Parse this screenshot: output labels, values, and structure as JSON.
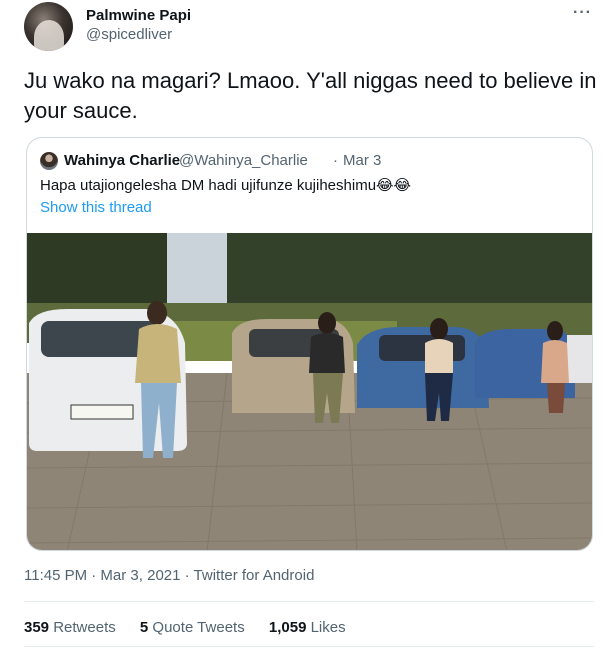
{
  "author": {
    "name": "Palmwine Papi",
    "handle": "@spicedliver"
  },
  "more_icon": "more-dots-icon",
  "tweet_text": "Ju wako na magari? Lmaoo. Y'all niggas need to believe in your sauce.",
  "quote": {
    "name": "Wahinya Charlie",
    "handle": "@Wahinya_Charlie",
    "separator": "·",
    "date": "Mar 3",
    "text": "Hapa utajiongelesha DM hadi ujifunze kujiheshimu😂😂",
    "show_thread": "Show this thread"
  },
  "meta": "11:45 PM · Mar 3, 2021 · Twitter for Android",
  "stats": {
    "retweets_count": "359",
    "retweets_label": "Retweets",
    "quotes_count": "5",
    "quotes_label": "Quote Tweets",
    "likes_count": "1,059",
    "likes_label": "Likes"
  },
  "colors": {
    "accent": "#1d9bf0",
    "secondary_text": "#536471",
    "border": "#cfd9de"
  }
}
